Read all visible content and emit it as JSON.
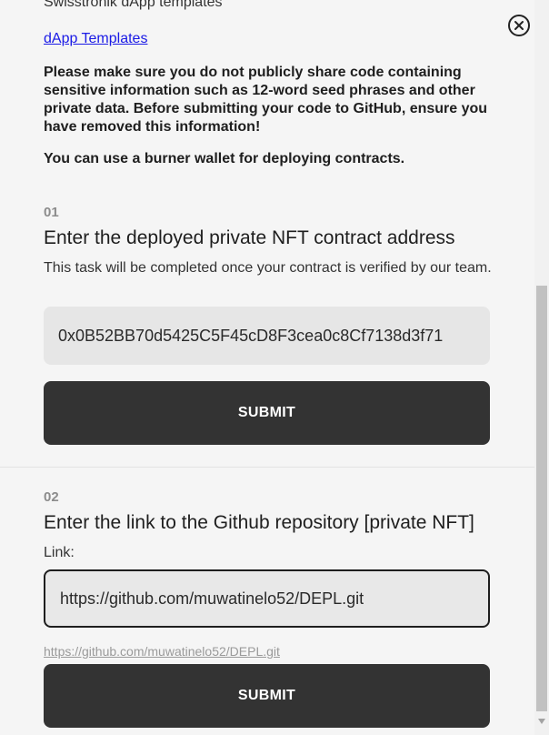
{
  "header": {
    "templates_heading": "Swisstronik dApp templates",
    "templates_link": "dApp Templates",
    "warning": "Please make sure you do not publicly share code containing sensitive information such as 12-word seed phrases and other private data. Before submitting your code to GitHub, ensure you have removed this information!",
    "burner_note": "You can use a burner wallet for deploying contracts."
  },
  "steps": [
    {
      "number": "01",
      "title": "Enter the deployed private NFT contract address",
      "description": "This task will be completed once your contract is verified by our team.",
      "input_value": "0x0B52BB70d5425C5F45cD8F3cea0c8Cf7138d3f71",
      "submit_label": "SUBMIT"
    },
    {
      "number": "02",
      "title": "Enter the link to the Github repository [private NFT]",
      "field_label": "Link:",
      "input_value": "https://github.com/muwatinelo52/DEPL.git",
      "submitted_link": "https://github.com/muwatinelo52/DEPL.git",
      "submit_label": "SUBMIT"
    }
  ],
  "icons": {
    "close": "close-circle-icon"
  }
}
